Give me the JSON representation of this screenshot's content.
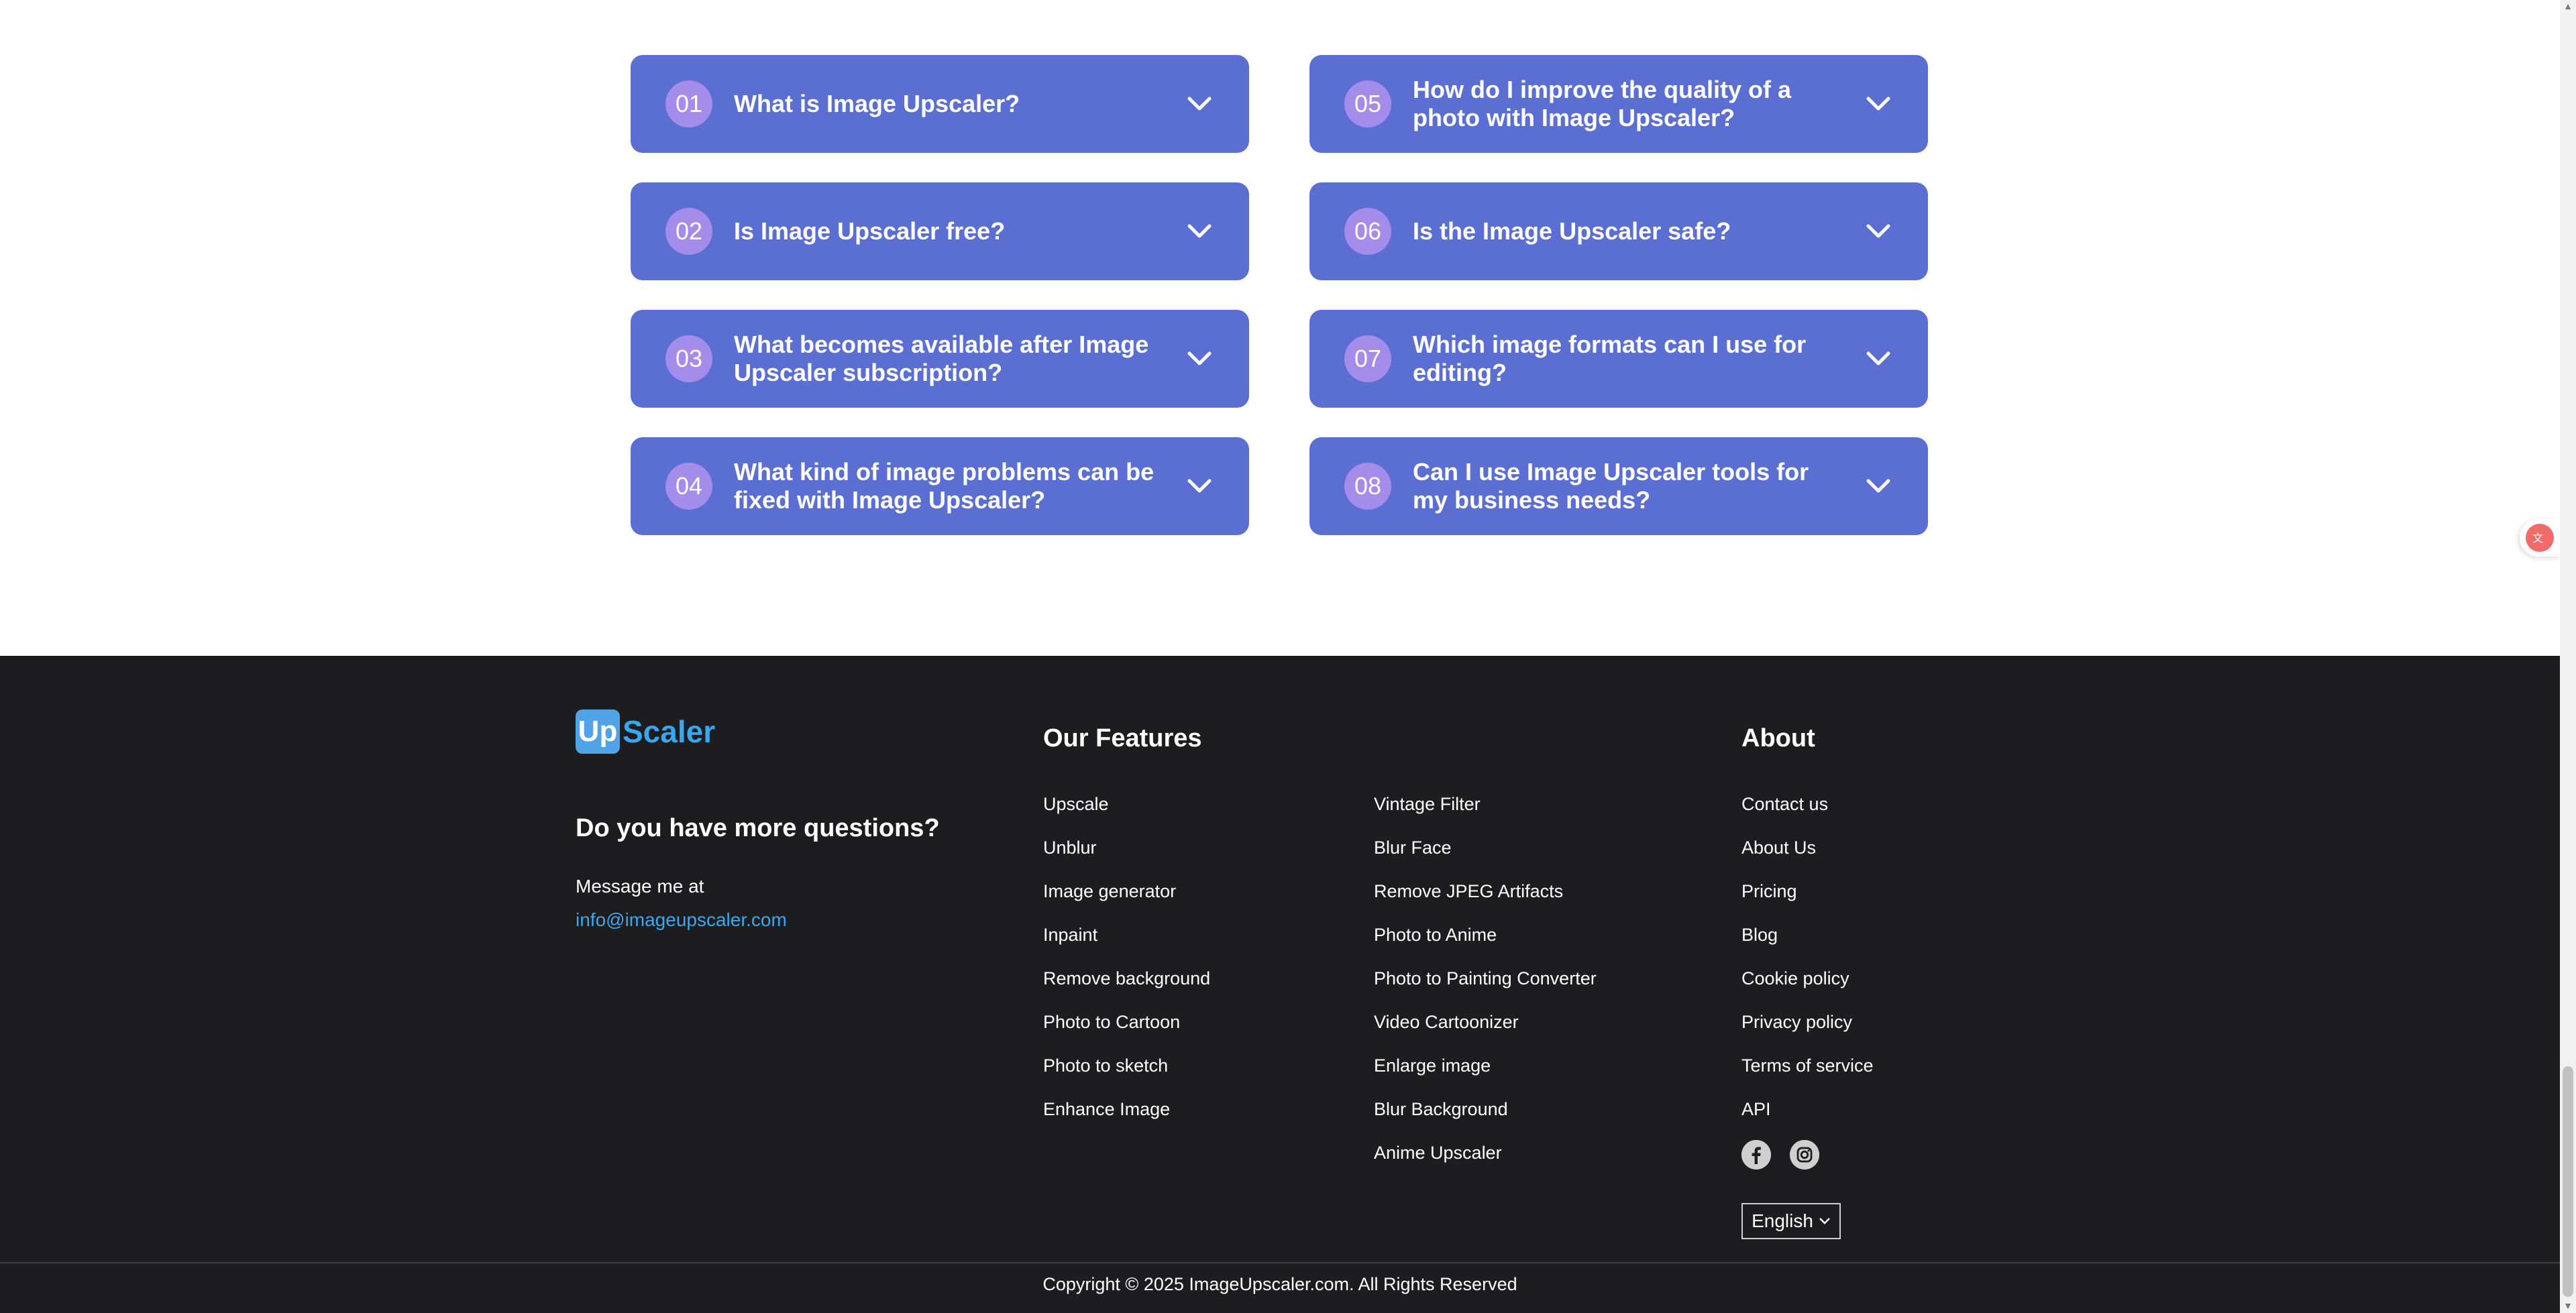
{
  "faq": {
    "items": [
      {
        "num": "01",
        "question": "What is Image Upscaler?"
      },
      {
        "num": "02",
        "question": "Is Image Upscaler free?"
      },
      {
        "num": "03",
        "question": "What becomes available after Image Upscaler subscription?"
      },
      {
        "num": "04",
        "question": "What kind of image problems can be fixed with Image Upscaler?"
      },
      {
        "num": "05",
        "question": "How do I improve the quality of a photo with Image Upscaler?"
      },
      {
        "num": "06",
        "question": "Is the Image Upscaler safe?"
      },
      {
        "num": "07",
        "question": "Which image formats can I use for editing?"
      },
      {
        "num": "08",
        "question": "Can I use Image Upscaler tools for my business needs?"
      }
    ]
  },
  "footer": {
    "logo": {
      "box": "Up",
      "text": "Scaler"
    },
    "questions_heading": "Do you have more questions?",
    "message_label": "Message me at",
    "email": "info@imageupscaler.com",
    "features_title": "Our Features",
    "features_col1": [
      "Upscale",
      "Unblur",
      "Image generator",
      "Inpaint",
      "Remove background",
      "Photo to Cartoon",
      "Photo to sketch",
      "Enhance Image"
    ],
    "features_col2": [
      "Vintage Filter",
      "Blur Face",
      "Remove JPEG Artifacts",
      "Photo to Anime",
      "Photo to Painting Converter",
      "Video Cartoonizer",
      "Enlarge image",
      "Blur Background",
      "Anime Upscaler"
    ],
    "about_title": "About",
    "about_links": [
      "Contact us",
      "About Us",
      "Pricing",
      "Blog",
      "Cookie policy",
      "Privacy policy",
      "Terms of service",
      "API"
    ],
    "social_icons": [
      "facebook-icon",
      "instagram-icon"
    ],
    "language": "English",
    "copyright": "Copyright © 2025 ImageUpscaler.com. All Rights Reserved"
  },
  "colors": {
    "faq_card": "#5b6fd2",
    "faq_number_badge": "#a48cea",
    "footer_bg": "#1d1d1f",
    "accent_blue": "#37a7f0"
  }
}
